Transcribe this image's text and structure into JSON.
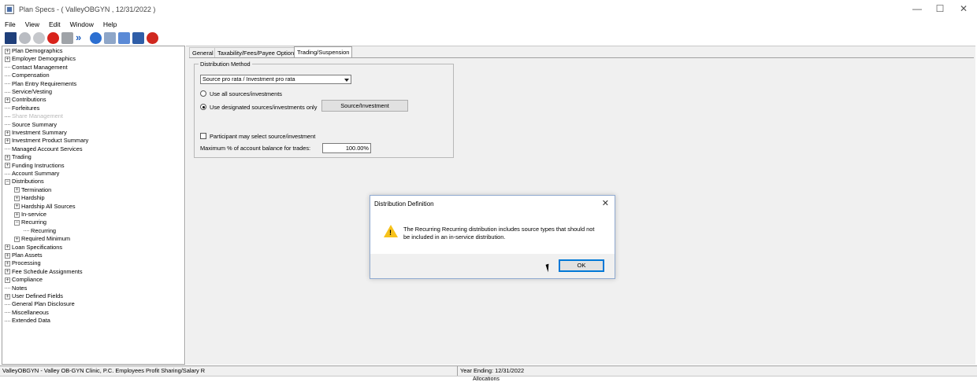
{
  "window": {
    "title": "Plan Specs - ( ValleyOBGYN , 12/31/2022 )",
    "controls": [
      "minimize-icon",
      "maximize-icon",
      "close-icon"
    ]
  },
  "menu": [
    "File",
    "View",
    "Edit",
    "Window",
    "Help"
  ],
  "toolbar": {
    "buttons": [
      "save-icon",
      "add-icon",
      "blank-icon",
      "delete-icon",
      "trash-icon",
      "forward-icon",
      "help-icon",
      "print-icon",
      "preview-icon",
      "report-icon",
      "exit-icon"
    ]
  },
  "tree": [
    {
      "label": "Plan Demographics",
      "exp": "+",
      "indent": 0
    },
    {
      "label": "Employer Demographics",
      "exp": "+",
      "indent": 0
    },
    {
      "label": "Contact Management",
      "exp": "",
      "indent": 0
    },
    {
      "label": "Compensation",
      "exp": "",
      "indent": 0
    },
    {
      "label": "Plan Entry Requirements",
      "exp": "",
      "indent": 0
    },
    {
      "label": "Service/Vesting",
      "exp": "",
      "indent": 0
    },
    {
      "label": "Contributions",
      "exp": "+",
      "indent": 0
    },
    {
      "label": "Forfeitures",
      "exp": "",
      "indent": 0
    },
    {
      "label": "Share Management",
      "exp": "",
      "indent": 0,
      "disabled": true
    },
    {
      "label": "Source Summary",
      "exp": "",
      "indent": 0
    },
    {
      "label": "Investment Summary",
      "exp": "+",
      "indent": 0
    },
    {
      "label": "Investment Product Summary",
      "exp": "+",
      "indent": 0
    },
    {
      "label": "Managed Account Services",
      "exp": "",
      "indent": 0
    },
    {
      "label": "Trading",
      "exp": "+",
      "indent": 0
    },
    {
      "label": "Funding Instructions",
      "exp": "+",
      "indent": 0
    },
    {
      "label": "Account Summary",
      "exp": "",
      "indent": 0
    },
    {
      "label": "Distributions",
      "exp": "−",
      "indent": 0
    },
    {
      "label": "Termination",
      "exp": "+",
      "indent": 1
    },
    {
      "label": "Hardship",
      "exp": "+",
      "indent": 1
    },
    {
      "label": "Hardship All Sources",
      "exp": "+",
      "indent": 1
    },
    {
      "label": "In-service",
      "exp": "+",
      "indent": 1
    },
    {
      "label": "Recurring",
      "exp": "−",
      "indent": 1
    },
    {
      "label": "Recurring",
      "exp": "",
      "indent": 2
    },
    {
      "label": "Required Minimum",
      "exp": "+",
      "indent": 1
    },
    {
      "label": "Loan Specifications",
      "exp": "+",
      "indent": 0
    },
    {
      "label": "Plan Assets",
      "exp": "+",
      "indent": 0
    },
    {
      "label": "Processing",
      "exp": "+",
      "indent": 0
    },
    {
      "label": "Fee Schedule Assignments",
      "exp": "+",
      "indent": 0
    },
    {
      "label": "Compliance",
      "exp": "+",
      "indent": 0
    },
    {
      "label": "Notes",
      "exp": "",
      "indent": 0
    },
    {
      "label": "User Defined Fields",
      "exp": "+",
      "indent": 0
    },
    {
      "label": "General Plan Disclosure",
      "exp": "",
      "indent": 0
    },
    {
      "label": "Miscellaneous",
      "exp": "",
      "indent": 0
    },
    {
      "label": "Extended Data",
      "exp": "",
      "indent": 0
    }
  ],
  "tabs": [
    "General",
    "Taxability/Fees/Payee Options",
    "Trading/Suspension"
  ],
  "active_tab": "Trading/Suspension",
  "distribution": {
    "legend": "Distribution Method",
    "method_value": "Source pro rata / Investment pro rata",
    "radio_all": "Use all sources/investments",
    "radio_designated": "Use designated sources/investments only",
    "source_button": "Source/Investment",
    "participant_checkbox": "Participant may select source/investment",
    "max_label": "Maximum % of account balance for trades:",
    "max_value": "100.00%"
  },
  "dialog": {
    "title": "Distribution Definition",
    "message": "The Recurring Recurring distribution includes source types that should not be included in an in-service distribution.",
    "ok_label": "OK"
  },
  "status": {
    "left": "ValleyOBGYN - Valley OB-GYN Clinic, P.C. Employees Profit Sharing/Salary R",
    "right": "Year Ending: 12/31/2022"
  },
  "bottom_strip": {
    "item": "Allocations"
  },
  "colors": {
    "dialog_border": "#8fa9cf",
    "accent": "#0078d7",
    "warning": "#f7c21b",
    "panel_bg": "#f0f0f0"
  }
}
